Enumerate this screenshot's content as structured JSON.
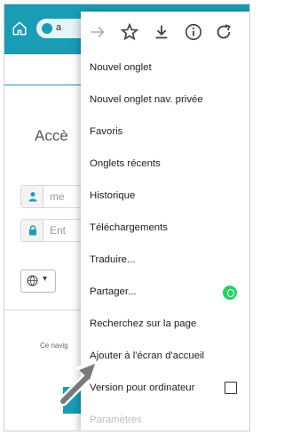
{
  "toolbar": {
    "url_fragment": "a"
  },
  "page": {
    "title_fragment": "Accè",
    "username_placeholder": "me",
    "password_placeholder": "Ent",
    "footer_fragment": "Ce navig"
  },
  "menu": {
    "top_icons": [
      "forward-icon",
      "star-icon",
      "download-icon",
      "info-icon",
      "refresh-icon"
    ],
    "items": [
      {
        "label": "Nouvel onglet"
      },
      {
        "label": "Nouvel onglet nav. privée"
      },
      {
        "label": "Favoris"
      },
      {
        "label": "Onglets récents"
      },
      {
        "label": "Historique"
      },
      {
        "label": "Téléchargements"
      },
      {
        "label": "Traduire..."
      },
      {
        "label": "Partager..."
      },
      {
        "label": "Recherchez sur la page"
      },
      {
        "label": "Ajouter à l'écran d'accueil"
      },
      {
        "label": "Version pour ordinateur"
      },
      {
        "label": "Paramètres"
      }
    ]
  },
  "colors": {
    "accent": "#1a9cb7",
    "whatsapp": "#25d366",
    "pointer": "#7a7a7a"
  }
}
